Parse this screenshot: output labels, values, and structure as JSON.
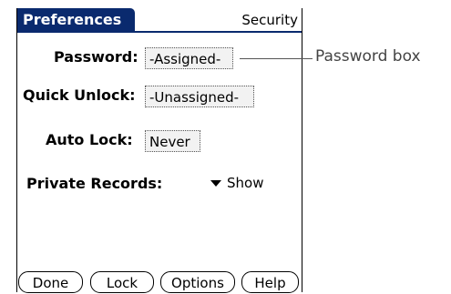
{
  "header": {
    "title": "Preferences",
    "category": "Security"
  },
  "fields": {
    "password": {
      "label": "Password:",
      "value": "-Assigned-"
    },
    "quick_unlock": {
      "label": "Quick Unlock:",
      "value": "-Unassigned-"
    },
    "auto_lock": {
      "label": "Auto Lock:",
      "value": "Never"
    },
    "private_records": {
      "label": "Private Records:",
      "value": "Show"
    }
  },
  "buttons": {
    "done": "Done",
    "lock": "Lock",
    "options": "Options",
    "help": "Help"
  },
  "annotation": {
    "text": "Password box"
  },
  "colors": {
    "title_bar": "#0a2a6e"
  }
}
